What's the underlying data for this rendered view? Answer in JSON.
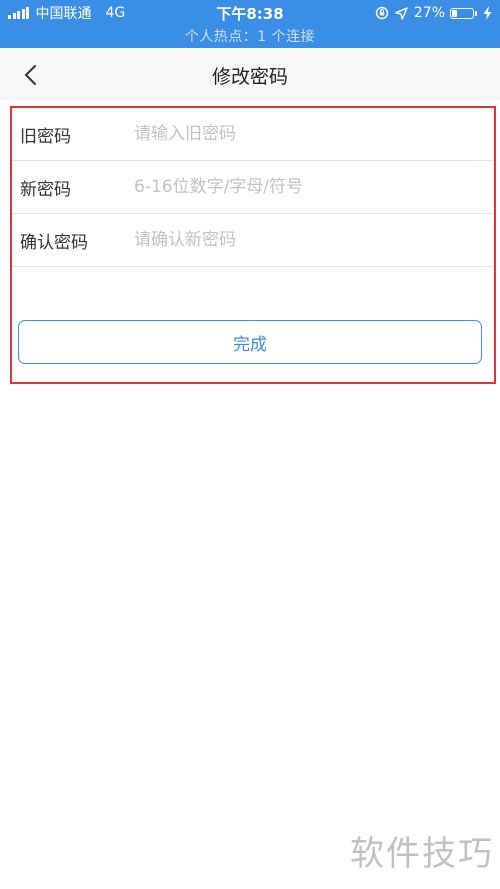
{
  "status_bar": {
    "carrier": "中国联通",
    "network": "4G",
    "time": "下午8:38",
    "battery_text": "27%",
    "battery_level": 0.27,
    "hotspot_text": "个人热点：1 个连接",
    "icons": [
      "signal-icon",
      "orientation-lock-icon",
      "location-icon",
      "battery-icon",
      "charging-icon"
    ]
  },
  "nav": {
    "back_icon": "chevron-left-icon",
    "title": "修改密码"
  },
  "form": {
    "fields": [
      {
        "label": "旧密码",
        "placeholder": "请输入旧密码",
        "value": ""
      },
      {
        "label": "新密码",
        "placeholder": "6-16位数字/字母/符号",
        "value": ""
      },
      {
        "label": "确认密码",
        "placeholder": "请确认新密码",
        "value": ""
      }
    ],
    "submit_label": "完成"
  },
  "watermark": "软件技巧",
  "colors": {
    "accent": "#3a8ee6",
    "highlight_border": "#e23434",
    "placeholder": "#c2c2c2"
  }
}
